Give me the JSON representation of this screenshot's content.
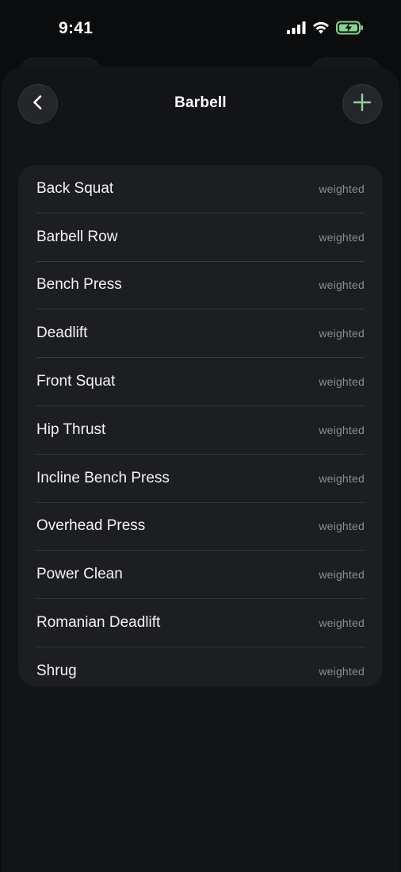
{
  "status_bar": {
    "time": "9:41"
  },
  "nav": {
    "title": "Barbell",
    "back_label": "Back",
    "add_label": "Add exercise"
  },
  "colors": {
    "accent": "#8ed1a0",
    "background": "#0b0c0e",
    "card": "#1d1e22",
    "battery": "#7ed88f"
  },
  "exercises": [
    {
      "name": "Back Squat",
      "type": "weighted"
    },
    {
      "name": "Barbell Row",
      "type": "weighted"
    },
    {
      "name": "Bench Press",
      "type": "weighted"
    },
    {
      "name": "Deadlift",
      "type": "weighted"
    },
    {
      "name": "Front Squat",
      "type": "weighted"
    },
    {
      "name": "Hip Thrust",
      "type": "weighted"
    },
    {
      "name": "Incline Bench Press",
      "type": "weighted"
    },
    {
      "name": "Overhead Press",
      "type": "weighted"
    },
    {
      "name": "Power Clean",
      "type": "weighted"
    },
    {
      "name": "Romanian Deadlift",
      "type": "weighted"
    },
    {
      "name": "Shrug",
      "type": "weighted"
    }
  ]
}
